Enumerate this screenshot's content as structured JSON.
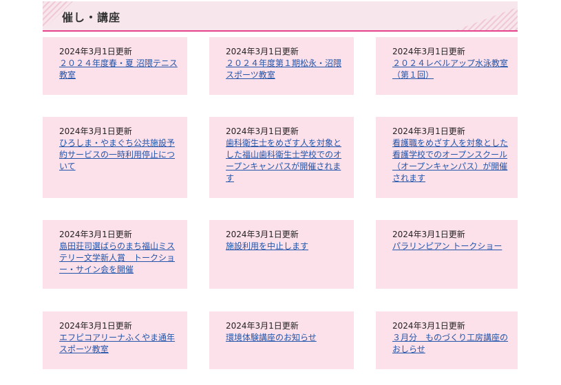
{
  "section": {
    "title": "催し・講座"
  },
  "cards": [
    {
      "date": "2024年3月1日更新",
      "link": "２０２４年度春・夏 沼隈テニス教室"
    },
    {
      "date": "2024年3月1日更新",
      "link": "２０２４年度第１期松永・沼隈スポーツ教室"
    },
    {
      "date": "2024年3月1日更新",
      "link": "２０２４レベルアップ水泳教室（第１回）"
    },
    {
      "date": "2024年3月1日更新",
      "link": "ひろしま・やまぐち公共施設予約サービスの一時利用停止について"
    },
    {
      "date": "2024年3月1日更新",
      "link": "歯科衛生士をめざす人を対象とした福山歯科衛生士学校でのオープンキャンパスが開催されます"
    },
    {
      "date": "2024年3月1日更新",
      "link": "看護職をめざす人を対象とした看護学校でのオープンスクール（オープンキャンパス）が開催されます"
    },
    {
      "date": "2024年3月1日更新",
      "link": "島田荘司選ばらのまち福山ミステリー文学新人賞　トークショー・サイン会を開催"
    },
    {
      "date": "2024年3月1日更新",
      "link": "施設利用を中止します"
    },
    {
      "date": "2024年3月1日更新",
      "link": "パラリンピアン トークショー"
    },
    {
      "date": "2024年3月1日更新",
      "link": "エフピコアリーナふくやま通年スポーツ教室"
    },
    {
      "date": "2024年3月1日更新",
      "link": "環境体験講座のお知らせ"
    },
    {
      "date": "2024年3月1日更新",
      "link": "３月分　ものづくり工房講座のおしらせ"
    }
  ]
}
